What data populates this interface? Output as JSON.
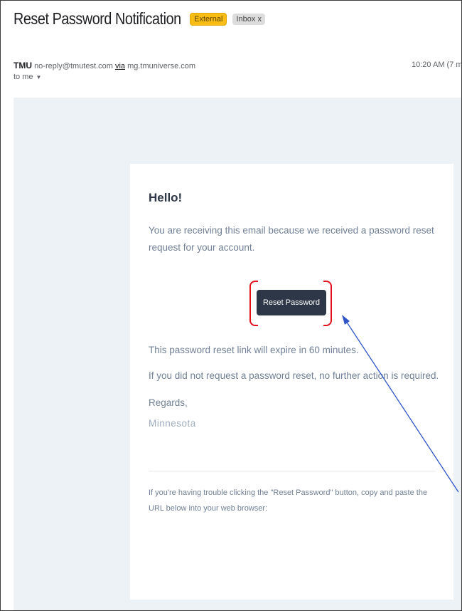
{
  "email": {
    "subject": "Reset Password Notification",
    "labels": {
      "external": "External",
      "inbox": "Inbox x"
    },
    "sender_name": "TMU",
    "sender_email": "no-reply@tmutest.com",
    "via_label": "via",
    "via_domain": "mg.tmuniverse.com",
    "time": "10:20 AM (7 m",
    "recipient": "to me"
  },
  "body": {
    "greeting": "Hello!",
    "intro": "You are receiving this email because we received a password reset request for your account.",
    "button_label": "Reset Password",
    "expire": "This password reset link will expire in 60 minutes.",
    "no_action": "If you did not request a password reset, no further action is required.",
    "regards": "Regards,",
    "signature": "Minnesota",
    "trouble": "If you're having trouble clicking the \"Reset Password\" button, copy and paste the URL below into your web browser:"
  },
  "colors": {
    "annotation_bracket": "#e3101e",
    "annotation_arrow": "#2f55c8",
    "button_bg": "#2d3748",
    "badge_external": "#f9bd15"
  }
}
